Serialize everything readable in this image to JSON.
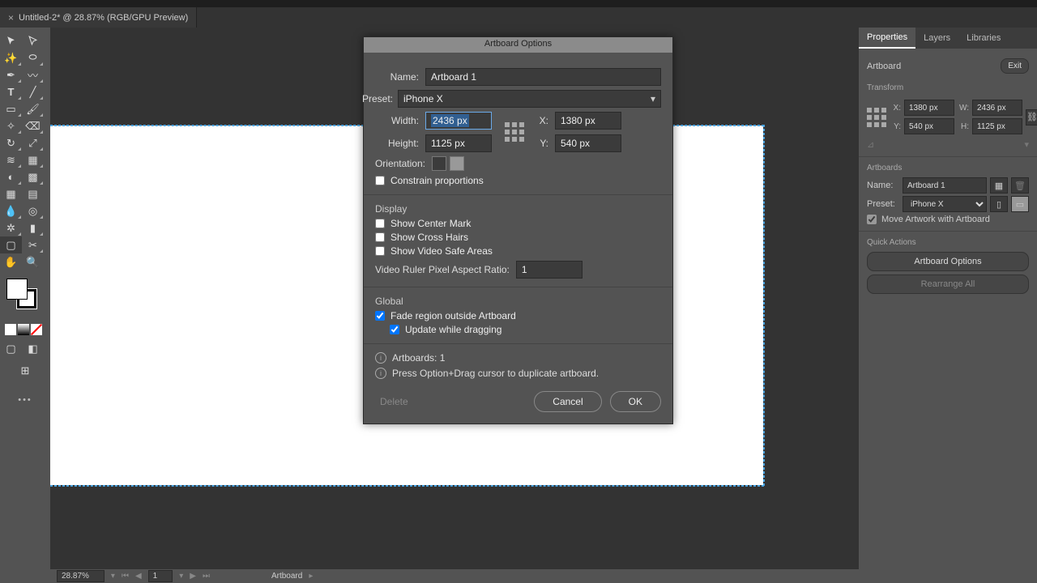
{
  "tab": {
    "title": "Untitled-2* @ 28.87% (RGB/GPU Preview)"
  },
  "dialog": {
    "title": "Artboard Options",
    "name_label": "Name:",
    "name_value": "Artboard 1",
    "preset_label": "Preset:",
    "preset_value": "iPhone X",
    "width_label": "Width:",
    "width_value": "2436 px",
    "height_label": "Height:",
    "height_value": "1125 px",
    "x_label": "X:",
    "x_value": "1380 px",
    "y_label": "Y:",
    "y_value": "540 px",
    "orientation_label": "Orientation:",
    "constrain_label": "Constrain proportions",
    "display_header": "Display",
    "show_center": "Show Center Mark",
    "show_cross": "Show Cross Hairs",
    "show_safe": "Show Video Safe Areas",
    "ruler_ratio_label": "Video Ruler Pixel Aspect Ratio:",
    "ruler_ratio_value": "1",
    "global_header": "Global",
    "fade_label": "Fade region outside Artboard",
    "update_label": "Update while dragging",
    "info1": "Artboards: 1",
    "info2": "Press Option+Drag cursor to duplicate artboard.",
    "delete": "Delete",
    "cancel": "Cancel",
    "ok": "OK"
  },
  "panel": {
    "tabs": {
      "properties": "Properties",
      "layers": "Layers",
      "libraries": "Libraries"
    },
    "object_type": "Artboard",
    "exit": "Exit",
    "transform_header": "Transform",
    "x_label": "X:",
    "x_value": "1380 px",
    "w_label": "W:",
    "w_value": "2436 px",
    "y_label": "Y:",
    "y_value": "540 px",
    "h_label": "H:",
    "h_value": "1125 px",
    "artboards_header": "Artboards",
    "name_label": "Name:",
    "name_value": "Artboard 1",
    "preset_label": "Preset:",
    "preset_value": "iPhone X",
    "move_artwork": "Move Artwork with Artboard",
    "quick_header": "Quick Actions",
    "btn_options": "Artboard Options",
    "btn_rearrange": "Rearrange All"
  },
  "footer": {
    "zoom": "28.87%",
    "nav_value": "1",
    "status": "Artboard"
  }
}
